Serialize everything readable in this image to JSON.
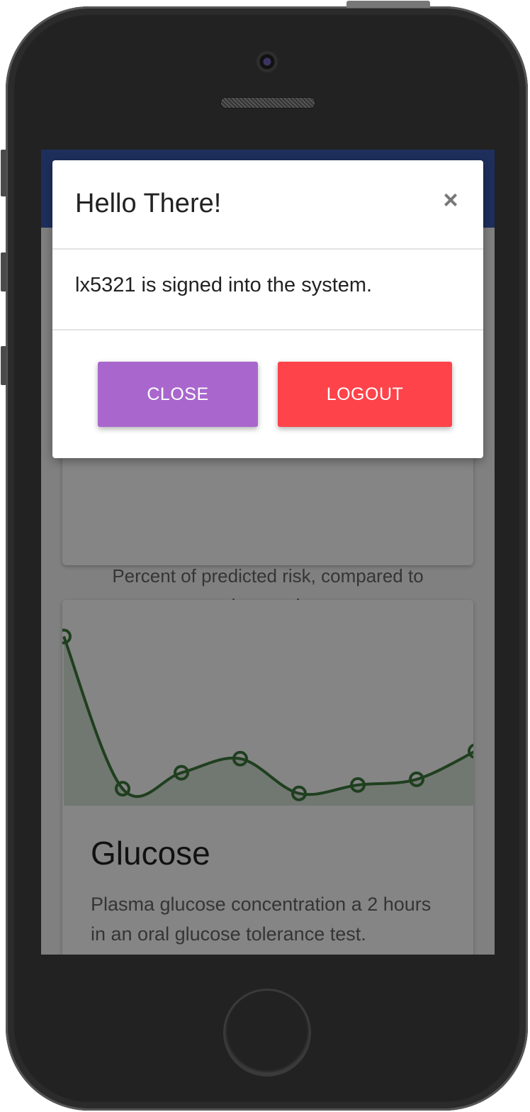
{
  "modal": {
    "title": "Hello There!",
    "close_icon": "×",
    "message": "lx5321 is signed into the system.",
    "close_label": "CLOSE",
    "logout_label": "LOGOUT"
  },
  "cards": {
    "risk": {
      "description": "Percent of predicted risk, compared to previous patients."
    },
    "glucose": {
      "title": "Glucose",
      "description": "Plasma glucose concentration a 2 hours in an oral glucose tolerance test."
    }
  },
  "chart_data": {
    "type": "line",
    "series": [
      {
        "values": [
          180,
          18,
          35,
          50,
          13,
          22,
          28,
          58
        ]
      }
    ],
    "ylim": [
      0,
      200
    ],
    "color": "#3c7a3c"
  },
  "colors": {
    "appbar": "#3b5bb0",
    "close_button": "#a967cd",
    "logout_button": "#fe434a"
  }
}
